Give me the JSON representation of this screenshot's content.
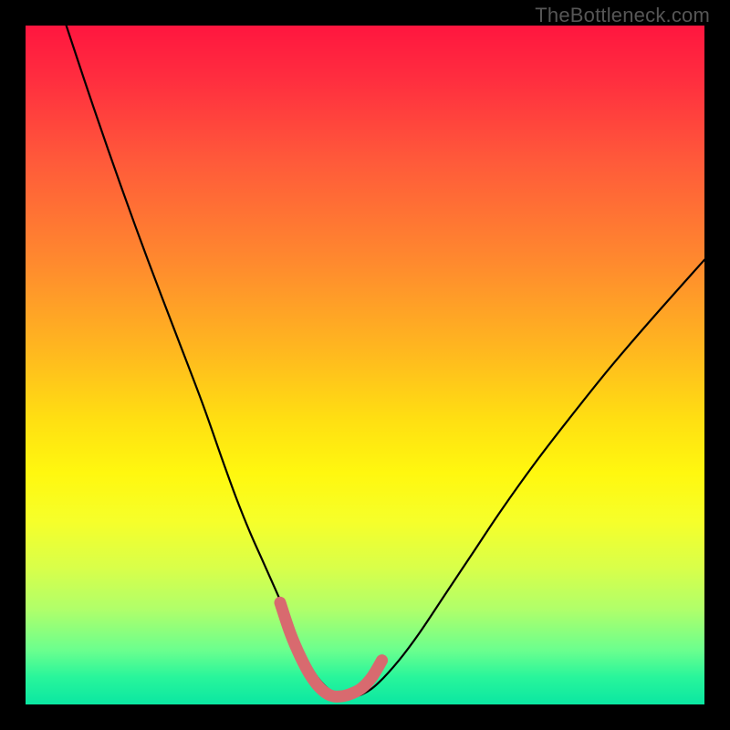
{
  "watermark": "TheBottleneck.com",
  "colors": {
    "background": "#000000",
    "curve_main": "#000000",
    "curve_highlight": "#d86a6f",
    "gradient_top": "#ff163f",
    "gradient_bottom": "#0be7a2"
  },
  "chart_data": {
    "type": "line",
    "title": "",
    "xlabel": "",
    "ylabel": "",
    "xlim": [
      0,
      100
    ],
    "ylim": [
      0,
      100
    ],
    "grid": false,
    "legend": false,
    "series": [
      {
        "name": "bottleneck-curve",
        "color": "#000000",
        "x": [
          6,
          10,
          14,
          18,
          22,
          26,
          29,
          31,
          33,
          35,
          37,
          38.5,
          40,
          41.5,
          43,
          45,
          47,
          48.5,
          50,
          52,
          55,
          58,
          62,
          66,
          70,
          75,
          80,
          86,
          92,
          100
        ],
        "y": [
          100,
          88,
          76.5,
          65.5,
          55,
          44.5,
          36,
          30.5,
          25.5,
          21,
          16.5,
          13,
          9.5,
          6.5,
          4,
          2,
          1.2,
          1.2,
          1.7,
          3.2,
          6.5,
          10.5,
          16.5,
          22.5,
          28.5,
          35.5,
          42,
          49.5,
          56.5,
          65.5
        ]
      },
      {
        "name": "optimal-band-highlight",
        "color": "#d86a6f",
        "x": [
          37.5,
          39,
          40.5,
          42,
          43.5,
          45,
          46.5,
          48,
          49.5,
          51,
          52.5
        ],
        "y": [
          15,
          10.5,
          7,
          4.2,
          2.3,
          1.3,
          1.2,
          1.6,
          2.4,
          4,
          6.5
        ]
      }
    ],
    "background_gradient": {
      "direction": "vertical",
      "stops": [
        {
          "pos": 0.0,
          "color": "#ff163f"
        },
        {
          "pos": 0.35,
          "color": "#ff8a2e"
        },
        {
          "pos": 0.58,
          "color": "#ffdf12"
        },
        {
          "pos": 0.8,
          "color": "#d8ff4a"
        },
        {
          "pos": 1.0,
          "color": "#0be7a2"
        }
      ]
    }
  }
}
